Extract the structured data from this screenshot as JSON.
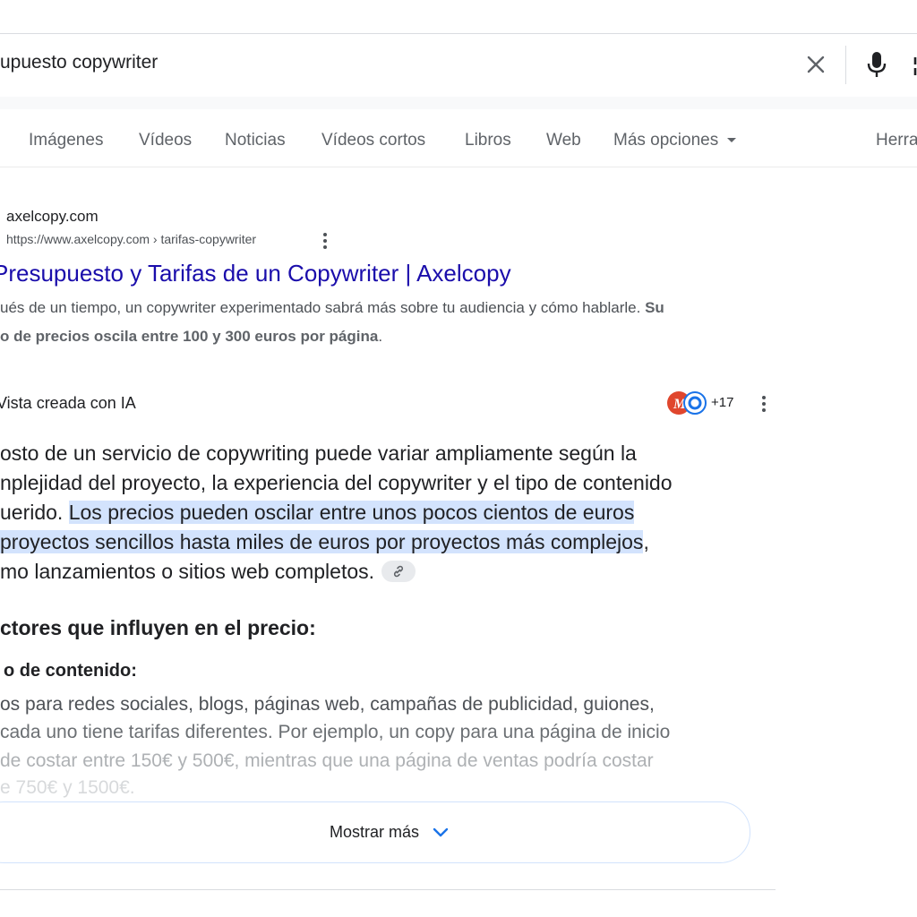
{
  "search": {
    "query": "upuesto copywriter"
  },
  "tabs": {
    "images": "Imágenes",
    "videos": "Vídeos",
    "news": "Noticias",
    "shorts": "Vídeos cortos",
    "books": "Libros",
    "web": "Web",
    "more": "Más opciones",
    "tools": "Herra"
  },
  "result": {
    "site_name": "axelcopy.com",
    "url": "https://www.axelcopy.com › tarifas-copywriter",
    "title": "Presupuesto y Tarifas de un Copywriter | Axelcopy",
    "snippet_1_plain": "ués de un tiempo, un copywriter experimentado sabrá más sobre tu audiencia y cómo hablarle. ",
    "snippet_1_bold": "Su",
    "snippet_2_bold": "o de precios oscila entre 100 y 300 euros por página",
    "snippet_2_plain": "."
  },
  "ai_overview": {
    "label": "Vista creada con IA",
    "sources_count": "+17",
    "line_1": "osto de un servicio de copywriting puede variar ampliamente según la",
    "line_2": "nplejidad del proyecto, la experiencia del copywriter y el tipo de contenido",
    "line_3_plain": "uerido. ",
    "line_3_highlight": "Los precios pueden oscilar entre unos pocos cientos de euros",
    "line_4_highlight": " proyectos sencillos hasta miles de euros por proyectos más complejos",
    "line_4_plain": ",",
    "line_5": "mo lanzamientos o sitios web completos.",
    "factors_title": "ctores que influyen en el precio:",
    "content_type_title": "o de contenido:",
    "fade_1": "os para redes sociales, blogs, páginas web, campañas de publicidad, guiones,",
    "fade_2": "cada uno tiene tarifas diferentes. Por ejemplo, un copy para una página de inicio",
    "fade_3": "de costar entre 150€ y 500€, mientras que una página de ventas podría costar",
    "fade_4": "e 750€ y 1500€.",
    "show_more": "Mostrar más"
  },
  "colors": {
    "link": "#1a0dab",
    "highlight": "#d3e3fd",
    "accent": "#1a73e8"
  }
}
